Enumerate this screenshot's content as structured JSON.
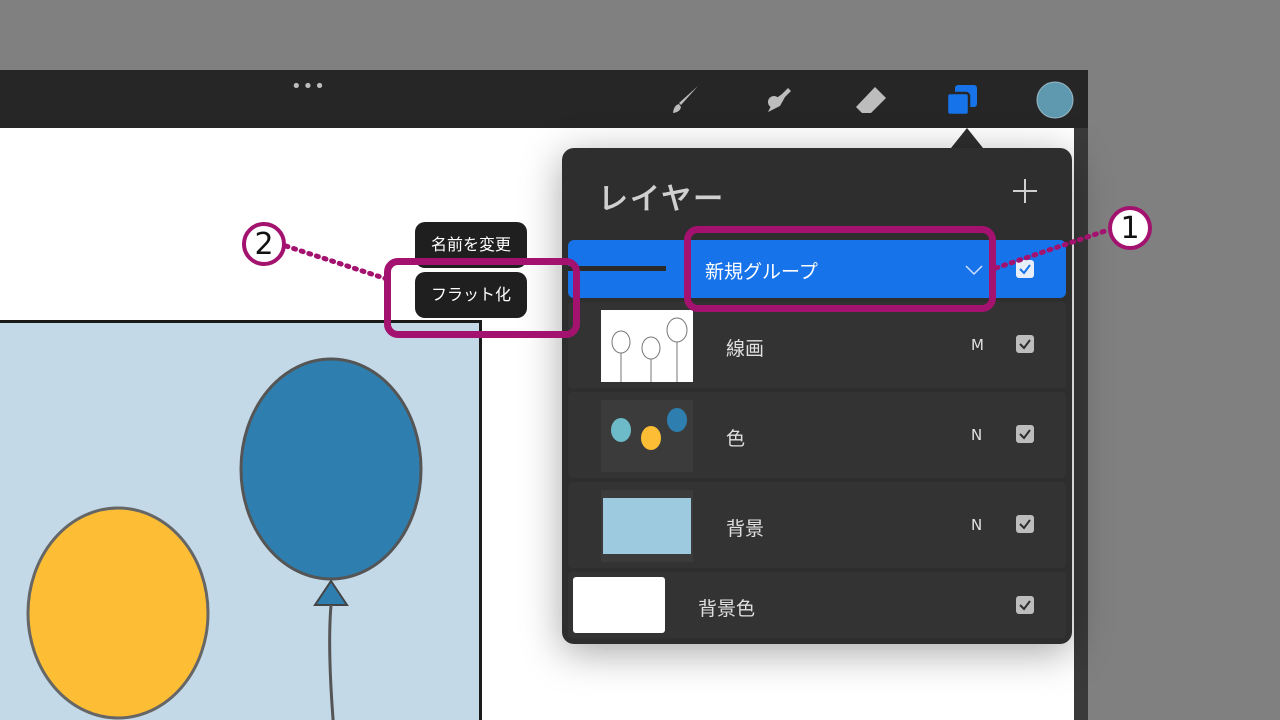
{
  "topbar": {
    "dots": "•••"
  },
  "tools": [
    "brush-icon",
    "smudge-icon",
    "eraser-icon",
    "layers-icon",
    "color-icon"
  ],
  "colors": {
    "accent": "#1673ea",
    "annotation": "#a3126e",
    "active_color": "#5e99b0"
  },
  "layers_panel": {
    "title": "レイヤー",
    "add_label": "+",
    "group": {
      "name": "新規グループ",
      "checked": true
    },
    "layers": [
      {
        "name": "線画",
        "mode": "M",
        "checked": true
      },
      {
        "name": "色",
        "mode": "N",
        "checked": true
      },
      {
        "name": "背景",
        "mode": "N",
        "checked": true
      }
    ],
    "background": {
      "name": "背景色",
      "checked": true
    }
  },
  "context_menu": {
    "rename": "名前を変更",
    "flatten": "フラット化"
  },
  "annotations": {
    "step1": "1",
    "step2": "2"
  }
}
